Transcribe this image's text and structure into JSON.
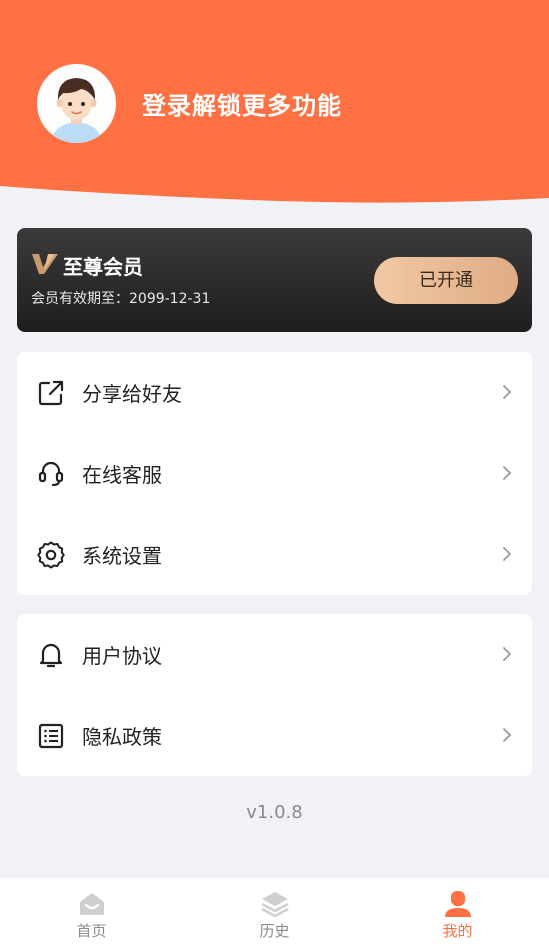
{
  "colors": {
    "accent": "#ff7043",
    "background": "#f1f2f6",
    "vip_gold": "#e8b88f"
  },
  "header": {
    "login_prompt": "登录解锁更多功能",
    "avatar_icon": "user-avatar-icon"
  },
  "vip": {
    "title": "至尊会员",
    "expiry": "会员有效期至：2099-12-31",
    "status_button": "已开通",
    "logo_icon": "vip-v-icon"
  },
  "menu_group_1": [
    {
      "label": "分享给好友",
      "icon": "share-icon"
    },
    {
      "label": "在线客服",
      "icon": "headset-icon"
    },
    {
      "label": "系统设置",
      "icon": "gear-icon"
    }
  ],
  "menu_group_2": [
    {
      "label": "用户协议",
      "icon": "bell-icon"
    },
    {
      "label": "隐私政策",
      "icon": "list-icon"
    }
  ],
  "version": "v1.0.8",
  "tabbar": [
    {
      "label": "首页",
      "icon": "home-icon",
      "active": false
    },
    {
      "label": "历史",
      "icon": "layers-icon",
      "active": false
    },
    {
      "label": "我的",
      "icon": "person-icon",
      "active": true
    }
  ]
}
